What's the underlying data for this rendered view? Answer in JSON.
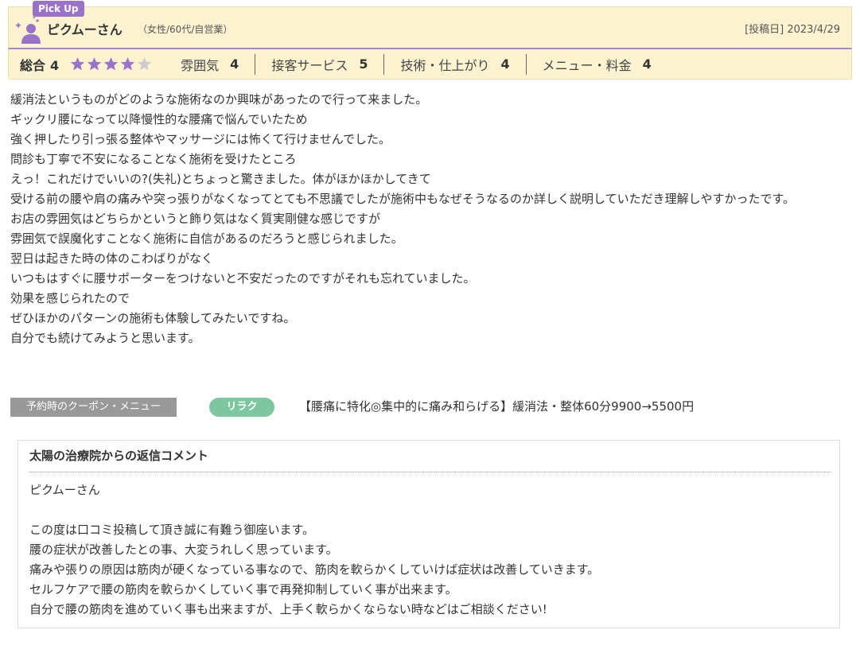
{
  "header": {
    "pickup_label": "Pick Up",
    "reviewer_name": "ピクムーさん",
    "reviewer_meta": "（女性/60代/自営業）",
    "post_date": "[投稿日] 2023/4/29",
    "avatar_icon": "user-avatar-icon",
    "accent_color": "#9a73c9"
  },
  "ratings": {
    "overall_label": "総合",
    "overall_value": "4",
    "stars_filled": 4,
    "stars_total": 5,
    "star_color": "#9a73c9",
    "items": [
      {
        "label": "雰囲気",
        "value": "4"
      },
      {
        "label": "接客サービス",
        "value": "5"
      },
      {
        "label": "技術・仕上がり",
        "value": "4"
      },
      {
        "label": "メニュー・料金",
        "value": "4"
      }
    ]
  },
  "review": {
    "lines": [
      "緩消法というものがどのような施術なのか興味があったので行って来ました。",
      "ギックリ腰になって以降慢性的な腰痛で悩んでいたため",
      "強く押したり引っ張る整体やマッサージには怖くて行けませんでした。",
      "問診も丁寧で不安になることなく施術を受けたところ",
      "えっ！これだけでいいの?(失礼)とちょっと驚きました。体がほかほかしてきて",
      "受ける前の腰や肩の痛みや突っ張りがなくなってとても不思議でしたが施術中もなぜそうなるのか詳しく説明していただき理解しやすかったです。",
      "お店の雰囲気はどちらかというと飾り気はなく質実剛健な感じですが",
      "雰囲気で誤魔化すことなく施術に自信があるのだろうと感じられました。",
      "翌日は起きた時の体のこわばりがなく",
      "いつもはすぐに腰サポーターをつけないと不安だったのですがそれも忘れていました。",
      "効果を感じられたので",
      "ぜひほかのパターンの施術も体験してみたいですね。",
      "自分でも続けてみようと思います。"
    ]
  },
  "coupon": {
    "tag_label": "予約時のクーポン・メニュー",
    "badge_label": "リラク",
    "text": "【腰痛に特化◎集中的に痛み和らげる】緩消法・整体60分9900→5500円",
    "badge_color": "#7cc6a0"
  },
  "reply": {
    "title": "太陽の治療院からの返信コメント",
    "lines": [
      "ピクムーさん",
      "",
      "この度は口コミ投稿して頂き誠に有難う御座います。",
      "腰の症状が改善したとの事、大変うれしく思っています。",
      "痛みや張りの原因は筋肉が硬くなっている事なので、筋肉を軟らかくしていけば症状は改善していきます。",
      "セルフケアで腰の筋肉を軟らかくしていく事で再発抑制していく事が出来ます。",
      "自分で腰の筋肉を進めていく事も出来ますが、上手く軟らかくならない時などはご相談ください!"
    ]
  }
}
